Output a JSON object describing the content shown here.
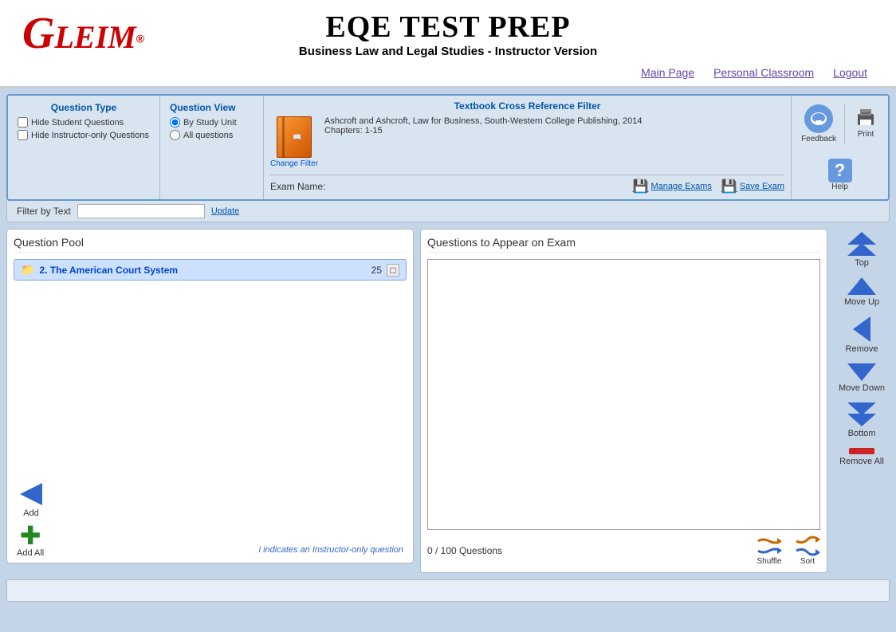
{
  "header": {
    "logo": "GLEIM",
    "main_title": "EQE Test Prep",
    "subtitle": "Business Law and Legal Studies - Instructor Version",
    "nav": {
      "main_page": "Main Page",
      "personal_classroom": "Personal Classroom",
      "logout": "Logout"
    }
  },
  "filter": {
    "title": "Textbook Cross Reference Filter",
    "question_type_title": "Question Type",
    "hide_student": "Hide Student Questions",
    "hide_instructor": "Hide Instructor-only Questions",
    "question_view_title": "Question View",
    "by_study_unit": "By Study Unit",
    "all_questions": "All questions",
    "book_line1": "Ashcroft and Ashcroft, Law for Business, South-Western College Publishing, 2014",
    "book_chapters": "Chapters: 1-15",
    "change_filter": "Change Filter",
    "feedback": "Feedback",
    "print": "Print",
    "help": "Help",
    "exam_name_label": "Exam Name:",
    "manage_exams": "Manage Exams",
    "save_exam": "Save Exam",
    "filter_by_text": "Filter by Text",
    "update": "Update"
  },
  "question_pool": {
    "title": "Question Pool",
    "item_name": "2. The American Court System",
    "item_count": "25",
    "add_label": "Add",
    "add_all_label": "Add All",
    "instructor_note": "i indicates an Instructor-only question"
  },
  "questions_panel": {
    "title": "Questions to Appear on Exam",
    "count": "0 / 100 Questions",
    "shuffle_label": "Shuffle",
    "sort_label": "Sort"
  },
  "side_controls": {
    "top": "Top",
    "move_up": "Move Up",
    "remove": "Remove",
    "move_down": "Move Down",
    "bottom": "Bottom",
    "remove_all": "Remove All"
  }
}
